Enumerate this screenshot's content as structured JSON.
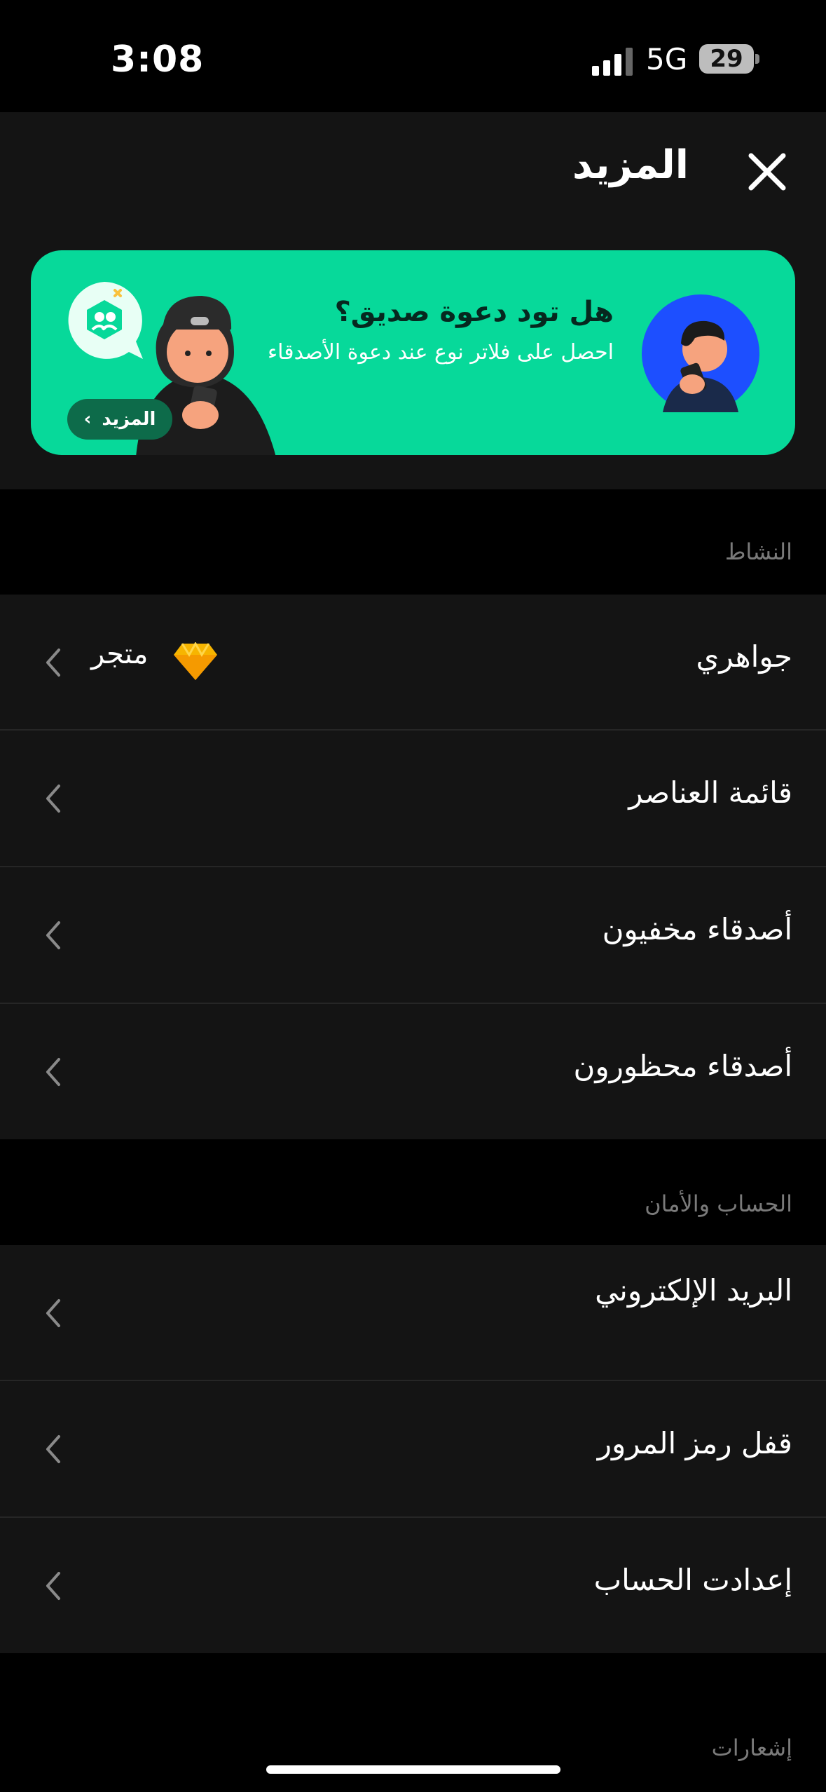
{
  "status": {
    "time": "3:08",
    "network": "5G",
    "battery": "29"
  },
  "header": {
    "title": "المزيد"
  },
  "banner": {
    "title": "هل تود دعوة صديق؟",
    "subtitle": "احصل على فلاتر نوع عند دعوة الأصدقاء",
    "more_label": "المزيد",
    "bg_color": "#07d99a"
  },
  "activity": {
    "label": "النشاط",
    "items": [
      {
        "label": "جواهري",
        "badge": "متجر",
        "icon": "gem-icon"
      },
      {
        "label": "قائمة العناصر"
      },
      {
        "label": "أصدقاء مخفيون"
      },
      {
        "label": "أصدقاء محظورون"
      }
    ]
  },
  "account": {
    "label": "الحساب والأمان",
    "items": [
      {
        "label": "البريد الإلكتروني"
      },
      {
        "label": "قفل رمز المرور"
      },
      {
        "label": "إعدادت الحساب"
      }
    ]
  },
  "notifications": {
    "label": "إشعارات"
  }
}
